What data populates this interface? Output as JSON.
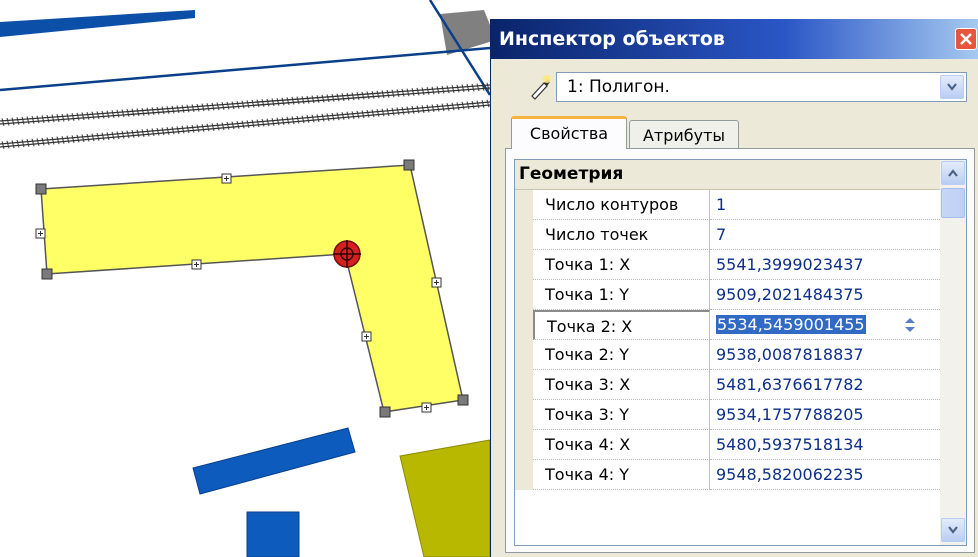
{
  "inspector": {
    "title": "Инспектор объектов",
    "selected_object": "1: Полигон.",
    "tabs": [
      {
        "label": "Свойства",
        "active": true
      },
      {
        "label": "Атрибуты",
        "active": false
      }
    ],
    "section_header": "Геометрия",
    "rows": [
      {
        "name": "Число контуров",
        "value": "1"
      },
      {
        "name": "Число точек",
        "value": "7"
      },
      {
        "name": "Точка 1: X",
        "value": "5541,3999023437"
      },
      {
        "name": "Точка 1: Y",
        "value": "9509,2021484375"
      },
      {
        "name": "Точка 2: X",
        "value": "5534,5459001455",
        "editing": true
      },
      {
        "name": "Точка 2: Y",
        "value": "9538,0087818837"
      },
      {
        "name": "Точка 3: X",
        "value": "5481,6376617782"
      },
      {
        "name": "Точка 3: Y",
        "value": "9534,1757788205"
      },
      {
        "name": "Точка 4: X",
        "value": "5480,5937518134"
      },
      {
        "name": "Точка 4: Y",
        "value": "9548,5820062235"
      }
    ]
  },
  "icons": [
    "magic-wand-icon",
    "close-icon",
    "chevron-down-icon",
    "scroll-up-icon",
    "scroll-down-icon",
    "spin-icon",
    "vertex-target-icon"
  ],
  "colors": {
    "title_bar": "#0a246a",
    "polygon_fill": "#ffff66",
    "selection_highlight": "#316ac5",
    "value_text": "#0c2f8a",
    "road_blue": "#0c5bbd",
    "building_olive": "#b8b800",
    "tab_accent": "#f6b13e"
  }
}
